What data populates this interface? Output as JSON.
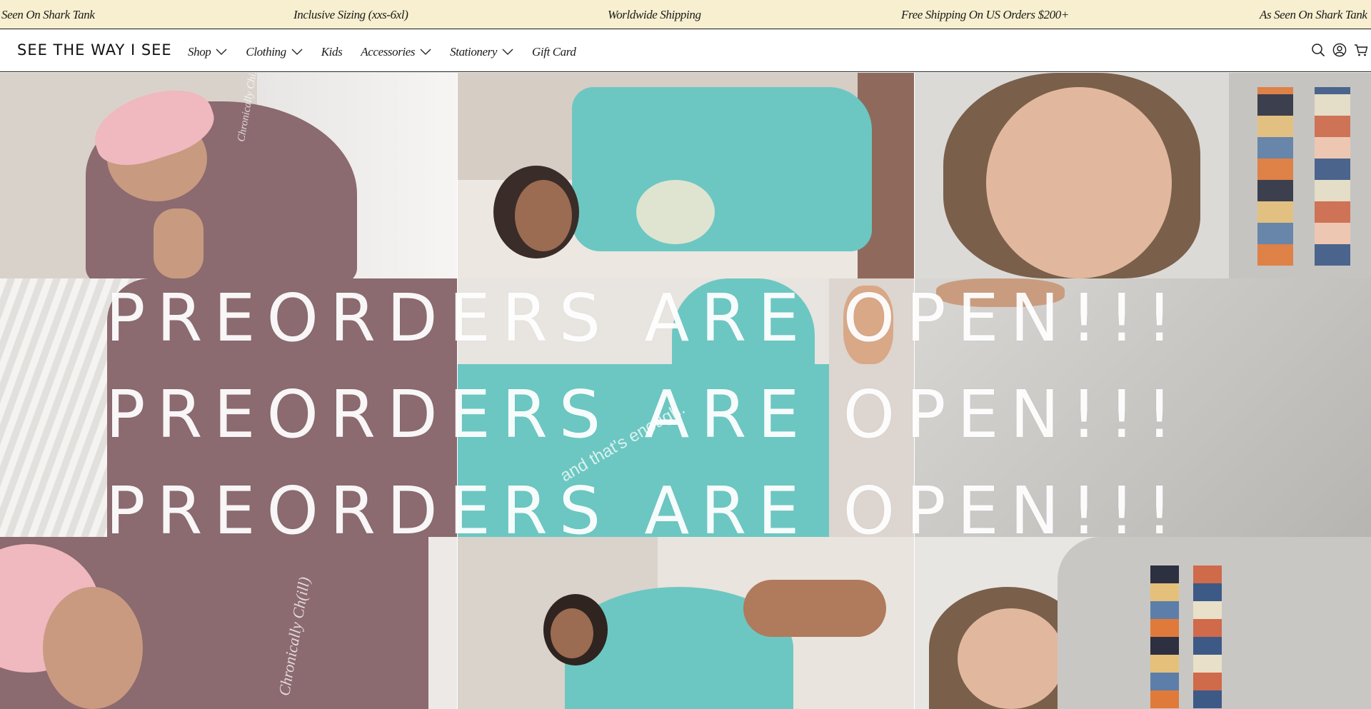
{
  "announcement": {
    "items": [
      "Seen On Shark Tank",
      "Inclusive Sizing (xxs-6xl)",
      "Worldwide Shipping",
      "Free Shipping On US Orders $200+",
      "As Seen On Shark Tank"
    ]
  },
  "header": {
    "logo": "SEE THE WAY I SEE",
    "nav": [
      {
        "label": "Shop",
        "dropdown": true
      },
      {
        "label": "Clothing",
        "dropdown": true
      },
      {
        "label": "Kids",
        "dropdown": false
      },
      {
        "label": "Accessories",
        "dropdown": true
      },
      {
        "label": "Stationery",
        "dropdown": true
      },
      {
        "label": "Gift Card",
        "dropdown": false
      }
    ],
    "icons": [
      "search-icon",
      "account-icon",
      "cart-icon"
    ]
  },
  "hero": {
    "headline_lines": [
      "PREORDERS ARE OPEN!!!",
      "PREORDERS ARE OPEN!!!",
      "PREORDERS ARE OPEN!!!"
    ],
    "embroidery": [
      "Chronically Chill",
      "and that's enough.",
      "Chronically Ch(ill)"
    ],
    "colors": {
      "mauve": "#8b6a70",
      "teal": "#6cc7c2",
      "grey": "#d8d6d3",
      "pink_cap": "#f0b8bf",
      "cream_bar": "#f7efcf"
    }
  }
}
